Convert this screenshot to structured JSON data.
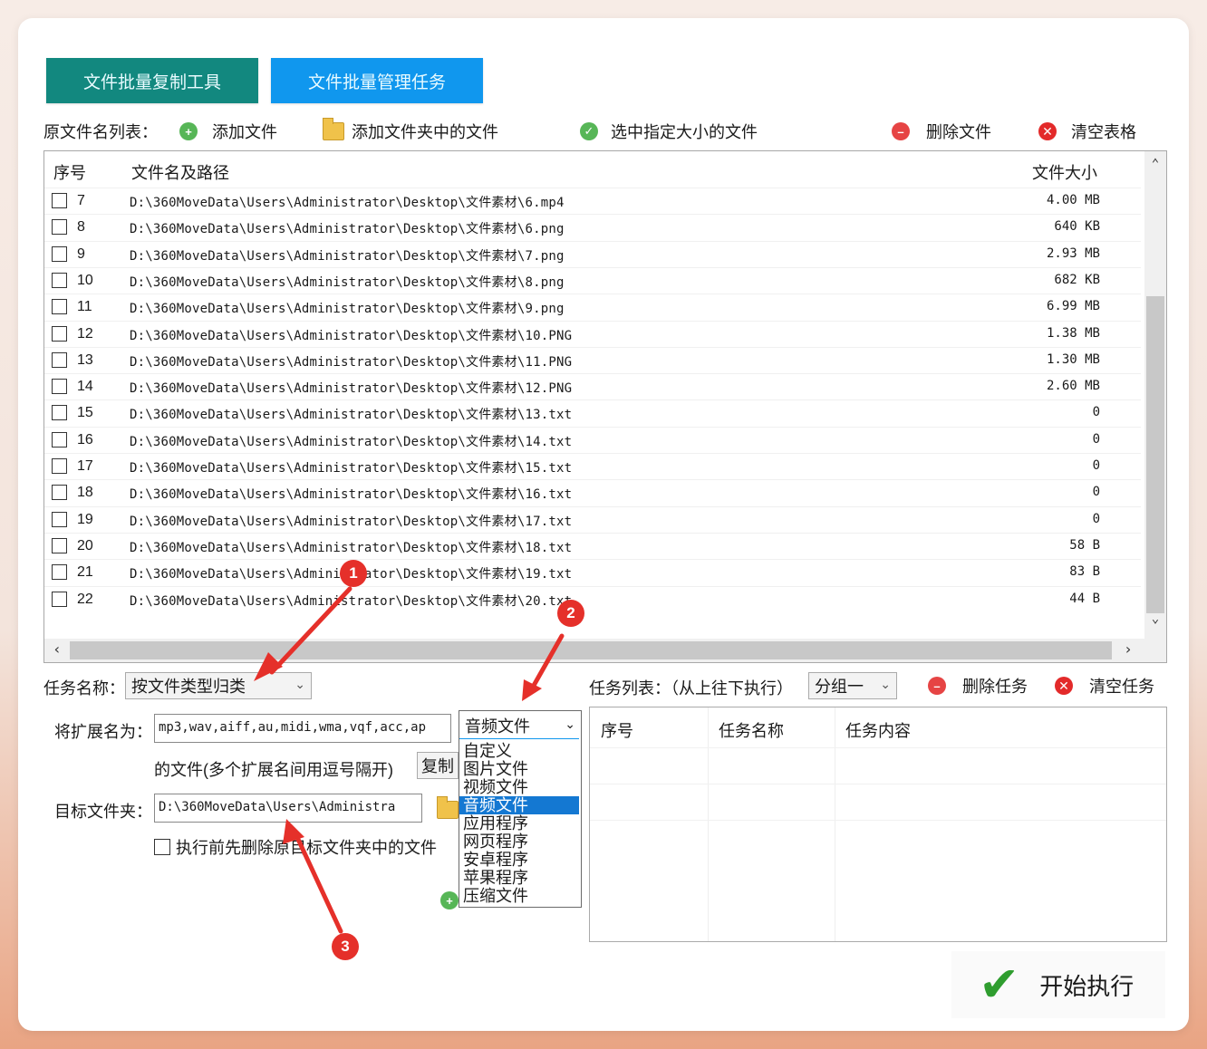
{
  "tabs": [
    {
      "label": "文件批量复制工具"
    },
    {
      "label": "文件批量管理任务"
    }
  ],
  "toolbar": {
    "list_label": "原文件名列表：",
    "add_file": "添加文件",
    "add_folder_files": "添加文件夹中的文件",
    "select_by_size": "选中指定大小的文件",
    "delete_file": "删除文件",
    "clear_table": "清空表格"
  },
  "file_table": {
    "col_no": "序号",
    "col_path": "文件名及路径",
    "col_size": "文件大小",
    "rows": [
      {
        "no": "7",
        "path": "D:\\360MoveData\\Users\\Administrator\\Desktop\\文件素材\\6.mp4",
        "size": "4.00 MB"
      },
      {
        "no": "8",
        "path": "D:\\360MoveData\\Users\\Administrator\\Desktop\\文件素材\\6.png",
        "size": "640 KB"
      },
      {
        "no": "9",
        "path": "D:\\360MoveData\\Users\\Administrator\\Desktop\\文件素材\\7.png",
        "size": "2.93 MB"
      },
      {
        "no": "10",
        "path": "D:\\360MoveData\\Users\\Administrator\\Desktop\\文件素材\\8.png",
        "size": "682 KB"
      },
      {
        "no": "11",
        "path": "D:\\360MoveData\\Users\\Administrator\\Desktop\\文件素材\\9.png",
        "size": "6.99 MB"
      },
      {
        "no": "12",
        "path": "D:\\360MoveData\\Users\\Administrator\\Desktop\\文件素材\\10.PNG",
        "size": "1.38 MB"
      },
      {
        "no": "13",
        "path": "D:\\360MoveData\\Users\\Administrator\\Desktop\\文件素材\\11.PNG",
        "size": "1.30 MB"
      },
      {
        "no": "14",
        "path": "D:\\360MoveData\\Users\\Administrator\\Desktop\\文件素材\\12.PNG",
        "size": "2.60 MB"
      },
      {
        "no": "15",
        "path": "D:\\360MoveData\\Users\\Administrator\\Desktop\\文件素材\\13.txt",
        "size": "0"
      },
      {
        "no": "16",
        "path": "D:\\360MoveData\\Users\\Administrator\\Desktop\\文件素材\\14.txt",
        "size": "0"
      },
      {
        "no": "17",
        "path": "D:\\360MoveData\\Users\\Administrator\\Desktop\\文件素材\\15.txt",
        "size": "0"
      },
      {
        "no": "18",
        "path": "D:\\360MoveData\\Users\\Administrator\\Desktop\\文件素材\\16.txt",
        "size": "0"
      },
      {
        "no": "19",
        "path": "D:\\360MoveData\\Users\\Administrator\\Desktop\\文件素材\\17.txt",
        "size": "0"
      },
      {
        "no": "20",
        "path": "D:\\360MoveData\\Users\\Administrator\\Desktop\\文件素材\\18.txt",
        "size": "58 B"
      },
      {
        "no": "21",
        "path": "D:\\360MoveData\\Users\\Administrator\\Desktop\\文件素材\\19.txt",
        "size": "83 B"
      },
      {
        "no": "22",
        "path": "D:\\360MoveData\\Users\\Administrator\\Desktop\\文件素材\\20.txt",
        "size": "44 B"
      }
    ]
  },
  "task": {
    "name_label": "任务名称：",
    "name_value": "按文件类型归类",
    "ext_label": "将扩展名为：",
    "ext_value": "mp3,wav,aiff,au,midi,wma,vqf,acc,ap",
    "ext_hint": "的文件(多个扩展名间用逗号隔开)",
    "copy_btn": "复制",
    "target_label": "目标文件夹：",
    "target_value": "D:\\360MoveData\\Users\\Administra",
    "delete_first": "执行前先删除原目标文件夹中的文件"
  },
  "type_dropdown": {
    "selected": "音频文件",
    "options": [
      "自定义",
      "图片文件",
      "视频文件",
      "音频文件",
      "应用程序",
      "网页程序",
      "安卓程序",
      "苹果程序",
      "压缩文件"
    ]
  },
  "tasklist": {
    "label": "任务列表：（从上往下执行）",
    "group_value": "分组一",
    "delete_task": "删除任务",
    "clear_task": "清空任务",
    "col_no": "序号",
    "col_name": "任务名称",
    "col_content": "任务内容"
  },
  "start": {
    "label": "开始执行"
  },
  "badges": [
    "1",
    "2",
    "3"
  ],
  "colors": {
    "tab1": "#12887f",
    "tab2": "#1097ee",
    "badge": "#e5302a"
  }
}
